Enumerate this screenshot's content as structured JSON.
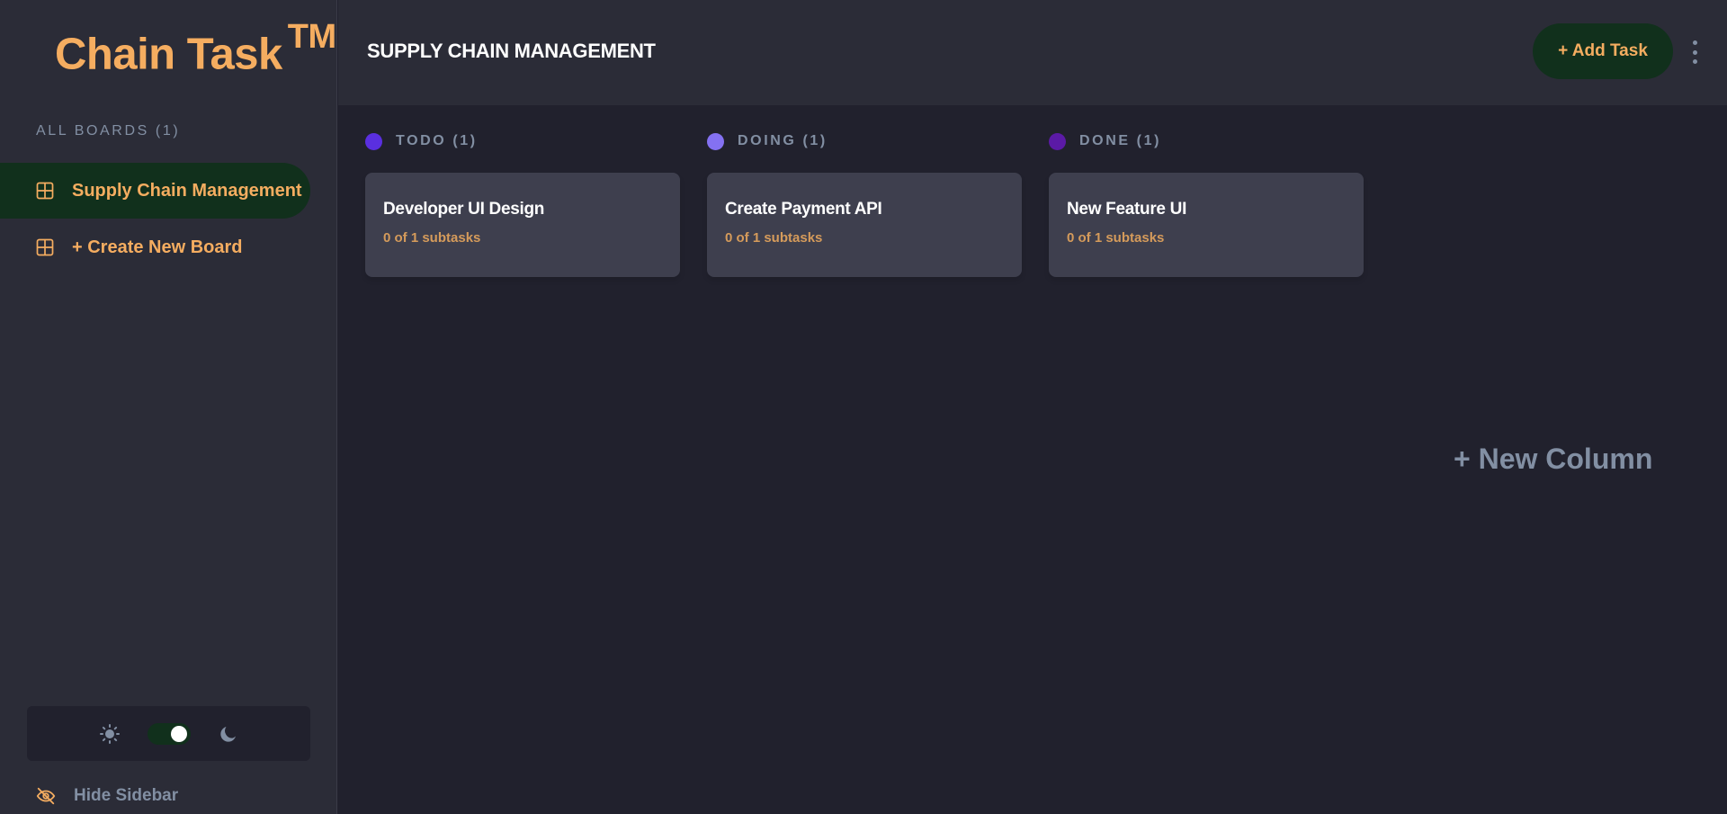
{
  "app": {
    "logo": "Chain Task",
    "logo_mark": "TM"
  },
  "sidebar": {
    "boards_heading": "ALL BOARDS (1)",
    "boards": [
      {
        "label": "Supply Chain Management",
        "active": true
      }
    ],
    "create_board_label": "+ Create New Board",
    "hide_label": "Hide Sidebar",
    "theme": {
      "mode": "dark",
      "toggle_on": true
    }
  },
  "header": {
    "board_title": "SUPPLY CHAIN MANAGEMENT",
    "add_task_label": "+ Add Task"
  },
  "columns": [
    {
      "title": "TODO (1)",
      "dot_color": "#5a2fe0",
      "tasks": [
        {
          "title": "Developer UI Design",
          "subtasks": "0 of 1 subtasks"
        }
      ]
    },
    {
      "title": "DOING (1)",
      "dot_color": "#8471f2",
      "tasks": [
        {
          "title": "Create Payment API",
          "subtasks": "0 of 1 subtasks"
        }
      ]
    },
    {
      "title": "DONE (1)",
      "dot_color": "#5b1aa6",
      "tasks": [
        {
          "title": "New Feature UI",
          "subtasks": "0 of 1 subtasks"
        }
      ]
    }
  ],
  "new_column_label": "+ New Column",
  "colors": {
    "accent": "#f5ad60",
    "accent_bg": "#11301c",
    "sidebar_bg": "#2b2c37",
    "board_bg": "#21212d",
    "card_bg": "#3e3f4e",
    "muted_text": "#828fa3"
  }
}
